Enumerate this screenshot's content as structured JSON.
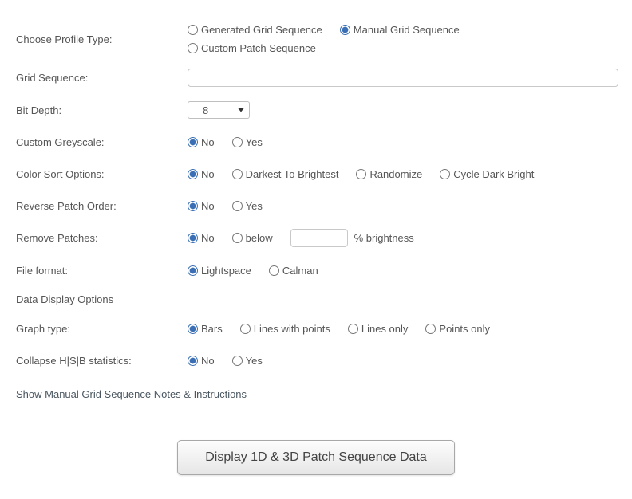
{
  "profile_type": {
    "label": "Choose Profile Type:",
    "opts": [
      "Generated Grid Sequence",
      "Manual Grid Sequence",
      "Custom Patch Sequence"
    ],
    "selected": 1
  },
  "grid_sequence": {
    "label": "Grid Sequence:",
    "value": ""
  },
  "bit_depth": {
    "label": "Bit Depth:",
    "value": "8"
  },
  "custom_greyscale": {
    "label": "Custom Greyscale:",
    "opts": [
      "No",
      "Yes"
    ],
    "selected": 0
  },
  "color_sort": {
    "label": "Color Sort Options:",
    "opts": [
      "No",
      "Darkest To Brightest",
      "Randomize",
      "Cycle Dark Bright"
    ],
    "selected": 0
  },
  "reverse_patch": {
    "label": "Reverse Patch Order:",
    "opts": [
      "No",
      "Yes"
    ],
    "selected": 0
  },
  "remove_patches": {
    "label": "Remove Patches:",
    "opts": [
      "No",
      "below"
    ],
    "selected": 0,
    "suffix": "% brightness",
    "value": ""
  },
  "file_format": {
    "label": "File format:",
    "opts": [
      "Lightspace",
      "Calman"
    ],
    "selected": 0
  },
  "data_display_head": "Data Display Options",
  "graph_type": {
    "label": "Graph type:",
    "opts": [
      "Bars",
      "Lines with points",
      "Lines only",
      "Points only"
    ],
    "selected": 0
  },
  "collapse_hsb": {
    "label": "Collapse H|S|B statistics:",
    "opts": [
      "No",
      "Yes"
    ],
    "selected": 0
  },
  "notes_link": "Show Manual Grid Sequence Notes & Instructions",
  "button": "Display 1D & 3D Patch Sequence Data"
}
